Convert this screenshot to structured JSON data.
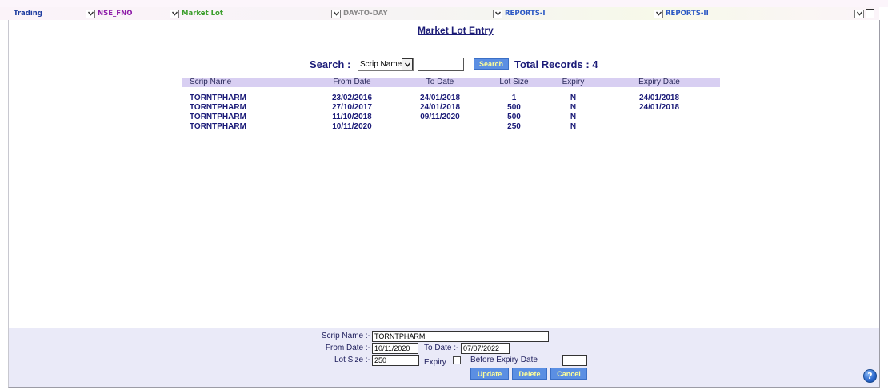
{
  "menu": {
    "items": [
      {
        "label": "Trading"
      },
      {
        "label": "NSE_FNO"
      },
      {
        "label": "Market Lot"
      },
      {
        "label": "DAY-TO-DAY"
      },
      {
        "label": "REPORTS-I"
      },
      {
        "label": "REPORTS-II"
      }
    ]
  },
  "icons": {
    "menu_dropdown": "chevron-down-icon",
    "select_dropdown": "chevron-down-icon",
    "help": "help-icon"
  },
  "page_title": "Market Lot Entry",
  "search": {
    "label": "Search :",
    "field_selected": "Scrip Name",
    "query": "",
    "button_label": "Search",
    "total_label": "Total Records :",
    "total_count": "4"
  },
  "table": {
    "columns": [
      "Scrip Name",
      "From Date",
      "To Date",
      "Lot Size",
      "Expiry",
      "Expiry Date"
    ],
    "rows": [
      {
        "scrip": "TORNTPHARM",
        "from_date": "23/02/2016",
        "to_date": "24/01/2018",
        "lot_size": "1",
        "expiry": "N",
        "expiry_date": "24/01/2018"
      },
      {
        "scrip": "TORNTPHARM",
        "from_date": "27/10/2017",
        "to_date": "24/01/2018",
        "lot_size": "500",
        "expiry": "N",
        "expiry_date": "24/01/2018"
      },
      {
        "scrip": "TORNTPHARM",
        "from_date": "11/10/2018",
        "to_date": "09/11/2020",
        "lot_size": "500",
        "expiry": "N",
        "expiry_date": ""
      },
      {
        "scrip": "TORNTPHARM",
        "from_date": "10/11/2020",
        "to_date": "",
        "lot_size": "250",
        "expiry": "N",
        "expiry_date": ""
      }
    ]
  },
  "form": {
    "scrip_name": {
      "label": "Scrip Name :-",
      "value": "TORNTPHARM"
    },
    "from_date": {
      "label": "From Date :-",
      "value": "10/11/2020"
    },
    "to_date": {
      "label": "To Date :-",
      "value": "07/07/2022"
    },
    "lot_size": {
      "label": "Lot Size :-",
      "value": "250"
    },
    "expiry": {
      "label": "Expiry",
      "checked": false
    },
    "before_expiry_date": {
      "label": "Before Expiry Date",
      "value": ""
    },
    "buttons": {
      "update": "Update",
      "delete": "Delete",
      "cancel": "Cancel"
    }
  },
  "help_glyph": "?",
  "colors": {
    "menu_trading": "#1f3da0",
    "menu_nse_fno": "#8e1ca8",
    "menu_market_lot": "#3b9e2c",
    "menu_day_to_day": "#8a8a8a",
    "menu_reports": "#2b58c4",
    "text_navy": "#1a1a78",
    "title_navy": "#1b1b76",
    "table_header_bg": "#d8cff2",
    "form_panel_bg": "#eaeaf8",
    "button_bg": "#5b8fe3",
    "button_text": "#ffff99"
  }
}
